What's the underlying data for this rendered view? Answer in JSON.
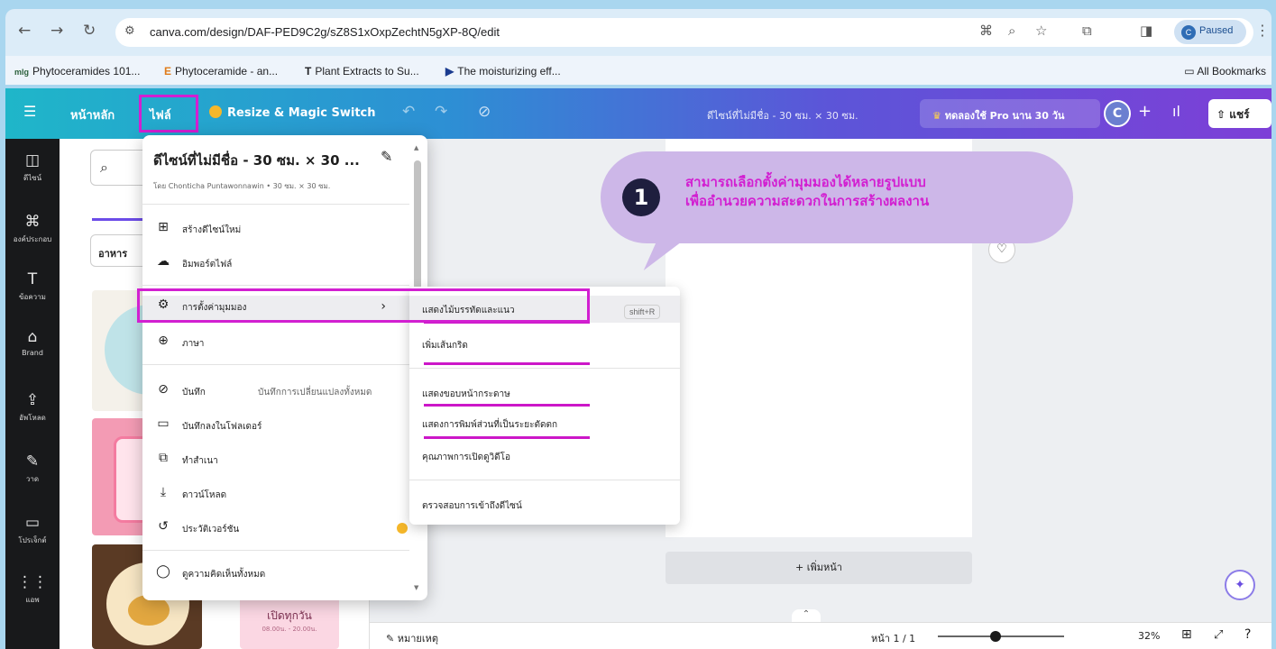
{
  "browser": {
    "url": "canva.com/design/DAF-PED9C2g/sZ8S1xOxpZechtN5gXP-8Q/edit",
    "profile_status": "Paused",
    "profile_initial": "C",
    "bookmarks": [
      "Phytoceramides 101...",
      "Phytoceramide - an...",
      "Plant Extracts to Su...",
      "The moisturizing eff..."
    ],
    "all_bookmarks": "All Bookmarks"
  },
  "canva_top": {
    "home": "หน้าหลัก",
    "file": "ไฟล์",
    "resize": "Resize & Magic Switch",
    "design_title": "ดีไซน์ที่ไม่มีชื่อ - 30 ซม. × 30 ซม.",
    "pro_trial": "ทดลองใช้ Pro นาน 30 วัน",
    "avatar_initial": "C",
    "share": "แชร์"
  },
  "rail": [
    {
      "icon": "◫",
      "label": "ดีไซน์"
    },
    {
      "icon": "⌘",
      "label": "องค์ประกอบ"
    },
    {
      "icon": "T",
      "label": "ข้อความ"
    },
    {
      "icon": "⌂",
      "label": "Brand"
    },
    {
      "icon": "⇪",
      "label": "อัพโหลด"
    },
    {
      "icon": "✎",
      "label": "วาด"
    },
    {
      "icon": "▭",
      "label": "โปรเจ็กต์"
    },
    {
      "icon": "⋮⋮",
      "label": "แอพ"
    }
  ],
  "panel": {
    "chip": "อาหาร",
    "thumb_text": "เปิดทุกวัน",
    "thumb_sub": "08.00น. - 20.00น."
  },
  "file_menu": {
    "title": "ดีไซน์ที่ไม่มีชื่อ - 30 ซม. × 30 ...",
    "subtitle": "โดย Chonticha Puntawonnawin • 30 ซม. × 30 ซม.",
    "items": [
      {
        "label": "สร้างดีไซน์ใหม่"
      },
      {
        "label": "อิมพอร์ตไฟล์"
      },
      {
        "label": "การตั้งค่ามุมมอง"
      },
      {
        "label": "ภาษา"
      },
      {
        "label": "บันทึก",
        "right": "บันทึกการเปลี่ยนแปลงทั้งหมด"
      },
      {
        "label": "บันทึกลงในโฟลเดอร์"
      },
      {
        "label": "ทำสำเนา"
      },
      {
        "label": "ดาวน์โหลด"
      },
      {
        "label": "ประวัติเวอร์ชัน"
      },
      {
        "label": "ดูความคิดเห็นทั้งหมด"
      }
    ]
  },
  "view_submenu": {
    "items": [
      {
        "label": "แสดงไม้บรรทัดและแนว",
        "shortcut": "shift+R"
      },
      {
        "label": "เพิ่มเส้นกริด"
      },
      {
        "label": "แสดงขอบหน้ากระดาษ"
      },
      {
        "label": "แสดงการพิมพ์ส่วนที่เป็นระยะตัดตก"
      },
      {
        "label": "คุณภาพการเปิดดูวิดีโอ"
      },
      {
        "label": "ตรวจสอบการเข้าถึงดีไซน์"
      }
    ]
  },
  "callout": {
    "step": "1",
    "line1": "สามารถเลือกตั้งค่ามุมมองได้หลายรูปแบบ",
    "line2": "เพื่ออำนวยความสะดวกในการสร้างผลงาน"
  },
  "canvas": {
    "add_page": "+ เพิ่มหน้า"
  },
  "bottom": {
    "notes": "หมายเหตุ",
    "page": "หน้า 1 / 1",
    "zoom": "32%"
  },
  "colors": {
    "highlight": "#d21fd1",
    "callout_bg": "#cdb7e8",
    "callout_text": "#d21fd1"
  }
}
